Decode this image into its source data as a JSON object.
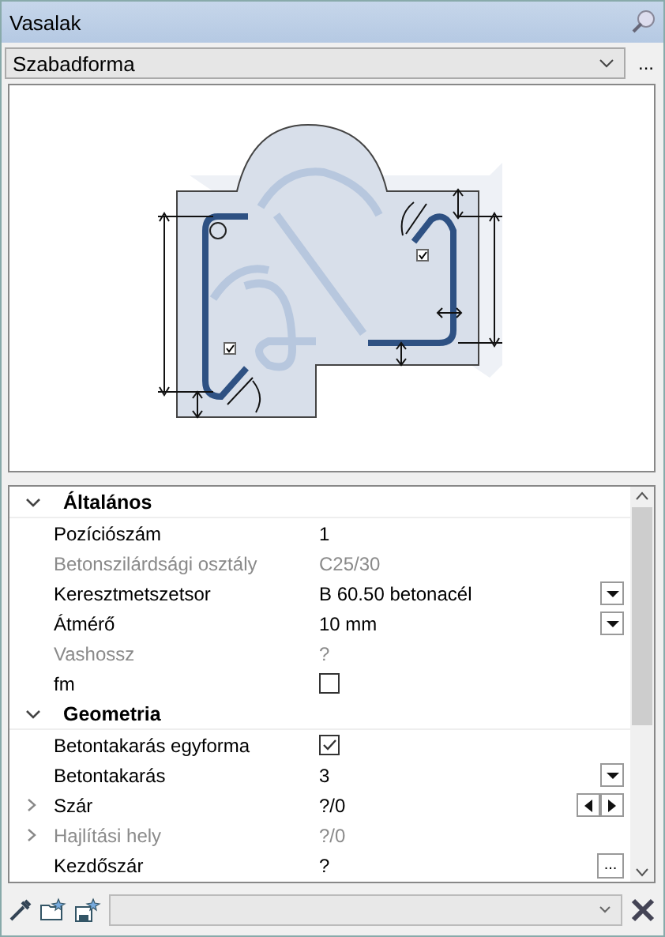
{
  "window": {
    "title": "Vasalak"
  },
  "shape_select": {
    "value": "Szabadforma",
    "more_button": "..."
  },
  "property_grid": {
    "sections": [
      {
        "title": "Általános",
        "expanded": true,
        "rows": [
          {
            "label": "Pozíciószám",
            "value": "1",
            "kind": "text",
            "disabled": false
          },
          {
            "label": "Betonszilárdsági osztály",
            "value": "C25/30",
            "kind": "text",
            "disabled": true
          },
          {
            "label": "Keresztmetszetsor",
            "value": "B 60.50 betonacél",
            "kind": "dropdown",
            "disabled": false
          },
          {
            "label": "Átmérő",
            "value": "10 mm",
            "kind": "dropdown",
            "disabled": false
          },
          {
            "label": "Vashossz",
            "value": "?",
            "kind": "text",
            "disabled": true
          },
          {
            "label": "fm",
            "kind": "checkbox",
            "checked": false,
            "disabled": false
          }
        ]
      },
      {
        "title": "Geometria",
        "expanded": true,
        "rows": [
          {
            "label": "Betontakarás egyforma",
            "kind": "checkbox",
            "checked": true,
            "disabled": false
          },
          {
            "label": "Betontakarás",
            "value": "3",
            "kind": "dropdown",
            "disabled": false
          },
          {
            "label": "Szár",
            "value": "?/0",
            "kind": "spinner",
            "disabled": false,
            "expanded": false
          },
          {
            "label": "Hajlítási hely",
            "value": "?/0",
            "kind": "text",
            "disabled": true,
            "expanded": false
          },
          {
            "label": "Kezdőszár",
            "value": "?",
            "kind": "ellipsis",
            "button_text": "...",
            "disabled": false
          }
        ]
      }
    ]
  }
}
